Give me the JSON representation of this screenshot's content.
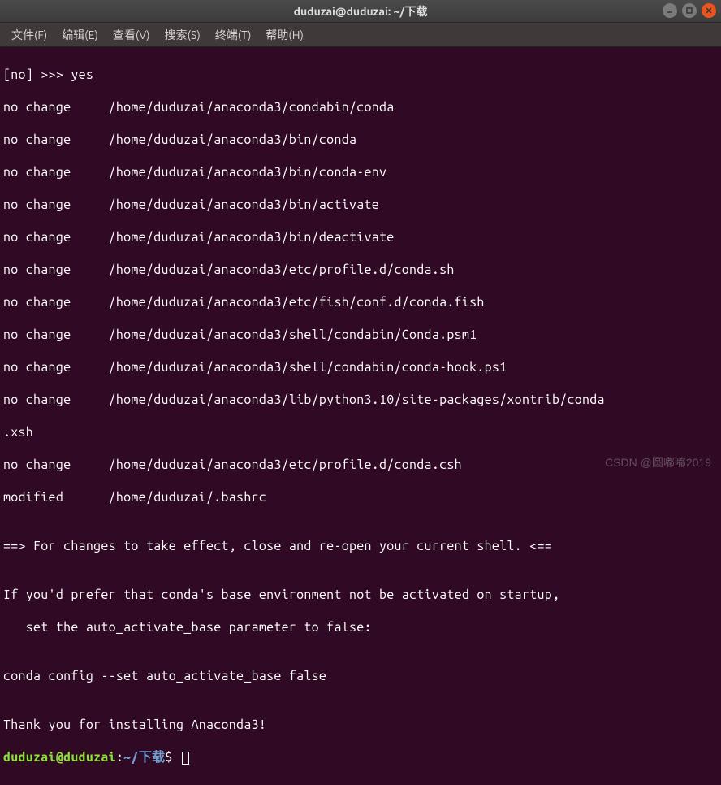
{
  "window": {
    "title": "duduzai@duduzai: ~/下载"
  },
  "menubar": {
    "items": [
      "文件(F)",
      "编辑(E)",
      "查看(V)",
      "搜索(S)",
      "终端(T)",
      "帮助(H)"
    ]
  },
  "terminal": {
    "lines": [
      "[no] >>> yes",
      "no change     /home/duduzai/anaconda3/condabin/conda",
      "no change     /home/duduzai/anaconda3/bin/conda",
      "no change     /home/duduzai/anaconda3/bin/conda-env",
      "no change     /home/duduzai/anaconda3/bin/activate",
      "no change     /home/duduzai/anaconda3/bin/deactivate",
      "no change     /home/duduzai/anaconda3/etc/profile.d/conda.sh",
      "no change     /home/duduzai/anaconda3/etc/fish/conf.d/conda.fish",
      "no change     /home/duduzai/anaconda3/shell/condabin/Conda.psm1",
      "no change     /home/duduzai/anaconda3/shell/condabin/conda-hook.ps1",
      "no change     /home/duduzai/anaconda3/lib/python3.10/site-packages/xontrib/conda",
      ".xsh",
      "no change     /home/duduzai/anaconda3/etc/profile.d/conda.csh",
      "modified      /home/duduzai/.bashrc",
      "",
      "==> For changes to take effect, close and re-open your current shell. <==",
      "",
      "If you'd prefer that conda's base environment not be activated on startup,",
      "   set the auto_activate_base parameter to false:",
      "",
      "conda config --set auto_activate_base false",
      "",
      "Thank you for installing Anaconda3!"
    ],
    "prompt": {
      "user_host": "duduzai@duduzai",
      "separator": ":",
      "path": "~/下载",
      "symbol": "$"
    }
  },
  "watermark": "CSDN @圆嘟嘟2019"
}
